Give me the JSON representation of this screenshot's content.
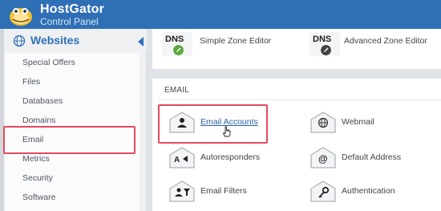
{
  "header": {
    "brand": "HostGator",
    "subtitle": "Control Panel"
  },
  "sidebar": {
    "title": "Websites",
    "items": [
      {
        "label": "Special Offers"
      },
      {
        "label": "Files"
      },
      {
        "label": "Databases"
      },
      {
        "label": "Domains"
      },
      {
        "label": "Email"
      },
      {
        "label": "Metrics"
      },
      {
        "label": "Security"
      },
      {
        "label": "Software"
      }
    ]
  },
  "dns": {
    "items": [
      {
        "icon_text": "DNS",
        "label": "Simple Zone Editor",
        "badge_color": "#5aa93b",
        "icon": "pencil-icon"
      },
      {
        "icon_text": "DNS",
        "label": "Advanced Zone Editor",
        "badge_color": "#444444",
        "icon": "pencil-icon"
      }
    ]
  },
  "email_section": {
    "title": "EMAIL",
    "tools": [
      {
        "label": "Email Accounts",
        "icon": "user-envelope-icon"
      },
      {
        "label": "Webmail",
        "icon": "globe-envelope-icon"
      },
      {
        "label": "Autoresponders",
        "icon": "autoresponder-envelope-icon"
      },
      {
        "label": "Default Address",
        "icon": "at-envelope-icon"
      },
      {
        "label": "Email Filters",
        "icon": "filter-envelope-icon"
      },
      {
        "label": "Authentication",
        "icon": "key-envelope-icon"
      }
    ]
  },
  "colors": {
    "header_blue": "#2f6fb6",
    "highlight_red": "#e44960",
    "link_blue": "#2b5fa3"
  }
}
